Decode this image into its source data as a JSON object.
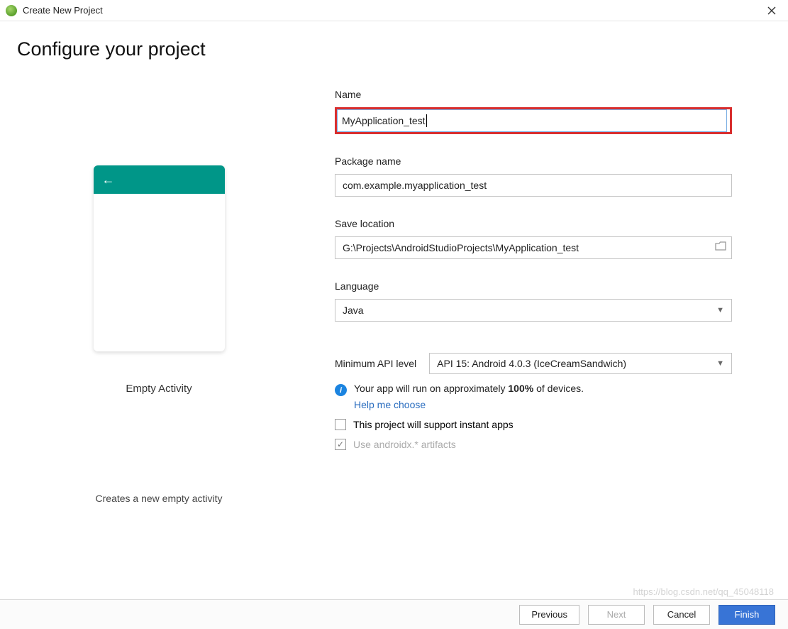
{
  "window": {
    "title": "Create New Project"
  },
  "page": {
    "heading": "Configure your project"
  },
  "preview": {
    "template_name": "Empty Activity",
    "template_desc": "Creates a new empty activity"
  },
  "form": {
    "name_label": "Name",
    "name_value": "MyApplication_test",
    "package_label": "Package name",
    "package_value": "com.example.myapplication_test",
    "save_label": "Save location",
    "save_value": "G:\\Projects\\AndroidStudioProjects\\MyApplication_test",
    "language_label": "Language",
    "language_value": "Java",
    "api_label": "Minimum API level",
    "api_value": "API 15: Android 4.0.3 (IceCreamSandwich)",
    "info_prefix": "Your app will run on approximately ",
    "info_pct": "100%",
    "info_suffix": " of devices.",
    "help_link": "Help me choose",
    "instant_apps_label": "This project will support instant apps",
    "androidx_label": "Use androidx.* artifacts"
  },
  "footer": {
    "previous": "Previous",
    "next": "Next",
    "cancel": "Cancel",
    "finish": "Finish"
  },
  "watermark": "https://blog.csdn.net/qq_45048118"
}
